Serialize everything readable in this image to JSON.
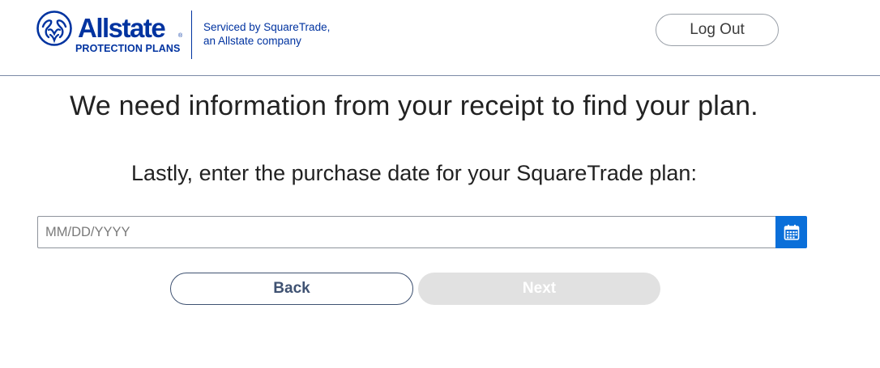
{
  "header": {
    "logo_wordmark": "Allstate",
    "logo_reg": "®",
    "logo_subtitle": "PROTECTION PLANS",
    "serviced_line1": "Serviced by SquareTrade,",
    "serviced_line2": "an Allstate company",
    "logout_label": "Log Out",
    "brand_color": "#0033a0"
  },
  "main": {
    "headline": "We need information from your receipt to find your plan.",
    "prompt": "Lastly, enter the purchase date for your SquareTrade plan:",
    "date_input": {
      "value": "",
      "placeholder": "MM/DD/YYYY",
      "icon": "calendar-icon",
      "icon_button_color": "#0a6fd9"
    },
    "buttons": {
      "back_label": "Back",
      "next_label": "Next",
      "next_disabled": true
    }
  }
}
